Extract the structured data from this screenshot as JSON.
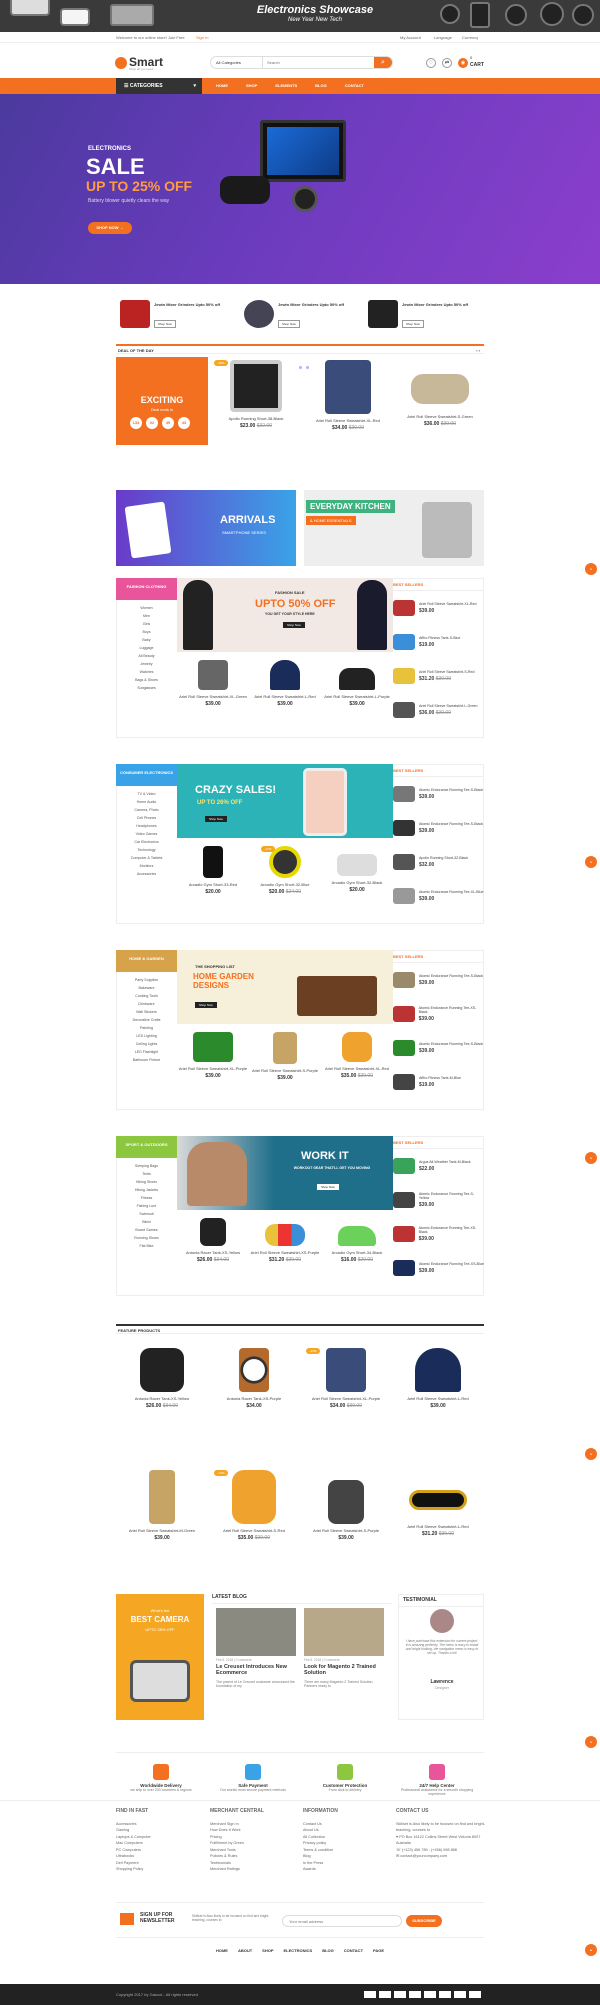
{
  "top_banner": {
    "title": "Electronics Showcase",
    "subtitle": "New Year New Tech"
  },
  "top_bar": {
    "welcome": "Welcome to our online store! Join Free",
    "signin": "Sign In",
    "account": "My Account",
    "language": "Language",
    "currency": "Currency"
  },
  "header": {
    "logo": "Smart",
    "tagline": "Shop all you need",
    "search_category": "All Categories",
    "search_placeholder": "Search",
    "cart_count": "0",
    "cart_label": "CART"
  },
  "nav": {
    "categories_label": "CATEGORIES",
    "items": [
      "HOME",
      "SHOP",
      "ELEMENTS",
      "BLOG",
      "CONTACT"
    ]
  },
  "hero": {
    "label": "ELECTRONICS",
    "sale": "SALE",
    "off": "UP TO 25% OFF",
    "desc": "Battery blower quietly clears the way",
    "button": "SHOP NOW"
  },
  "promos": [
    {
      "title": "Jewin Mixer Grinders Upto 50% off",
      "button": "Shop Now"
    },
    {
      "title": "Jewin Mixer Grinders Upto 50% off",
      "button": "Shop Now"
    },
    {
      "title": "Jewin Mixer Grinders Upto 50% off",
      "button": "Shop Now"
    }
  ],
  "deal": {
    "heading": "DEAL OF THE DAY",
    "exciting": "EXCITING",
    "ends": "Deal ends in",
    "timer": [
      "133",
      "02",
      "49",
      "43"
    ],
    "products": [
      {
        "name": "Apollo Running Short-38-Black",
        "price": "$23.00",
        "old": "$32.00"
      },
      {
        "name": "Ariel Roll Sleeve Sweatshirt-XL-Red",
        "price": "$34.00",
        "old": "$39.00"
      },
      {
        "name": "Ariel Roll Sleeve Sweatshirt-S-Green",
        "price": "$36.00",
        "old": "$39.00"
      }
    ]
  },
  "banners": {
    "arrivals": "ARRIVALS",
    "arrivals_sub": "SMARTPHONE SERIES",
    "kitchen": "EVERYDAY KITCHEN",
    "kitchen_sub": "& HOME ESSENTIALS"
  },
  "fashion": {
    "heading": "FASHION CLOTHING",
    "categories": [
      "Women",
      "Men",
      "Girls",
      "Boys",
      "Baby",
      "Luggage",
      "All Beauty",
      "Jewelry",
      "Watches",
      "Bags & Shoes",
      "Sunglasses"
    ],
    "banner_label": "FASHION SALE",
    "banner_title": "UPTO 50% OFF",
    "banner_sub": "YOU GET YOUR STYLE HERE",
    "banner_btn": "Shop Now",
    "products": [
      {
        "name": "Ariel Roll Sleeve Sweatshirt-XL-Green",
        "price": "$39.00"
      },
      {
        "name": "Ariel Roll Sleeve Sweatshirt-L-Red",
        "price": "$39.00"
      },
      {
        "name": "Ariel Roll Sleeve Sweatshirt-L-Purple",
        "price": "$39.00"
      }
    ],
    "best_head": "BEST SELLERS",
    "best": [
      {
        "name": "Ariel Roll Sleeve Sweatshirt-XL-Red",
        "price": "$39.00"
      },
      {
        "name": "Affiro Fitness Tank-S-Blue",
        "price": "$19.00"
      },
      {
        "name": "Ariel Roll Sleeve Sweatshirt-S-Red",
        "price": "$31.20",
        "old": "$39.00"
      },
      {
        "name": "Ariel Roll Sleeve Sweatshirt-L-Green",
        "price": "$36.00",
        "old": "$39.00"
      }
    ]
  },
  "consumer": {
    "heading": "CONSUMER ELECTRONICS",
    "categories": [
      "TV & Video",
      "Home Audio",
      "Camera, Photo",
      "Cell Phones",
      "Headphones",
      "Video Games",
      "Car Electronics",
      "Technology",
      "Computer & Tablets",
      "Monitors",
      "Accessories"
    ],
    "banner_title": "CRAZY SALES!",
    "banner_sub": "UP TO 26% OFF",
    "banner_btn": "Shop Now",
    "products": [
      {
        "name": "Arcadio Gym Short-33-Red",
        "price": "$20.00"
      },
      {
        "name": "Arcadio Gym Short-32-Blue",
        "price": "$20.00",
        "old": "$24.00"
      },
      {
        "name": "Arcadio Gym Short-32-Black",
        "price": "$20.00"
      }
    ],
    "best_head": "BEST SELLERS",
    "best": [
      {
        "name": "Atomic Endurance Running Tee-S-Black",
        "price": "$39.00"
      },
      {
        "name": "Atomic Endurance Running Tee-S-Black",
        "price": "$39.00"
      },
      {
        "name": "Apollo Running Short-32-Black",
        "price": "$32.00"
      },
      {
        "name": "Atomic Endurance Running Tee-XL-Blue",
        "price": "$39.00"
      }
    ]
  },
  "garden": {
    "heading": "HOME & GARDEN",
    "categories": [
      "Party Supplies",
      "Bakeware",
      "Cooking Tools",
      "Drinkware",
      "Wall Stickers",
      "Decorative Crafts",
      "Painting",
      "LED Lighting",
      "Ceiling Lights",
      "LED Flashlight",
      "Bathroom Fixture"
    ],
    "banner_label": "THE SHOPPING LIST",
    "banner_title": "HOME GARDEN DESIGNS",
    "banner_btn": "Shop Now",
    "products": [
      {
        "name": "Ariel Roll Sleeve Sweatshirt-XL-Purple",
        "price": "$39.00"
      },
      {
        "name": "Ariel Roll Sleeve Sweatshirt-S-Purple",
        "price": "$39.00"
      },
      {
        "name": "Ariel Roll Sleeve Sweatshirt-XL-Red",
        "price": "$35.00",
        "old": "$39.00"
      }
    ],
    "best_head": "BEST SELLERS",
    "best": [
      {
        "name": "Atomic Endurance Running Tee-S-Black",
        "price": "$39.00"
      },
      {
        "name": "Atomic Endurance Running Tee-XS-Black",
        "price": "$39.00"
      },
      {
        "name": "Atomic Endurance Running Tee-S-Black",
        "price": "$39.00"
      },
      {
        "name": "Affiro Fitness Tank-M-Blue",
        "price": "$19.00"
      }
    ]
  },
  "sport": {
    "heading": "SPORT & OUTDOORS",
    "categories": [
      "Sleeping Bags",
      "Tents",
      "Hiking Shoes",
      "Hiking Jackets",
      "Fitness",
      "Fishing Lure",
      "Swimsuit",
      "Bikini",
      "Board Games",
      "Running Shoes",
      "Flat Bike"
    ],
    "banner_title": "WORK IT",
    "banner_sub": "WORKOUT GEAR THAT'LL GET YOU MOVING",
    "banner_btn": "Shop Now",
    "products": [
      {
        "name": "Antonia Racer Tank-XS-Yellow",
        "price": "$26.00",
        "old": "$34.00"
      },
      {
        "name": "Ariel Roll Sleeve Sweatshirt-XS-Purple",
        "price": "$31.20",
        "old": "$39.00"
      },
      {
        "name": "Arcadio Gym Short-34-Black",
        "price": "$16.00",
        "old": "$20.00"
      }
    ],
    "best_head": "BEST SELLERS",
    "best": [
      {
        "name": "Argus All-Weather Tank-M-Black",
        "price": "$22.00"
      },
      {
        "name": "Atomic Endurance Running Tee-S-Yellow",
        "price": "$39.00"
      },
      {
        "name": "Atomic Endurance Running Tee-XS-Black",
        "price": "$39.00"
      },
      {
        "name": "Atomic Endurance Running Tee-XS-Blue",
        "price": "$39.00"
      }
    ]
  },
  "featured": {
    "heading": "FEATURE PRODUCTS",
    "products": [
      {
        "name": "Antonia Racer Tank-XS-Yellow",
        "price": "$26.00",
        "old": "$34.00"
      },
      {
        "name": "Antonia Racer Tank-XS-Purple",
        "price": "$34.00"
      },
      {
        "name": "Ariel Roll Sleeve Sweatshirt-XL-Purple",
        "price": "$34.00",
        "old": "$39.00"
      },
      {
        "name": "Ariel Roll Sleeve Sweatshirt-L-Red",
        "price": "$39.00"
      },
      {
        "name": "Ariel Roll Sleeve Sweatshirt-M-Green",
        "price": "$39.00"
      },
      {
        "name": "Ariel Roll Sleeve Sweatshirt-S-Red",
        "price": "$35.00",
        "old": "$39.00"
      },
      {
        "name": "Ariel Roll Sleeve Sweatshirt-S-Purple",
        "price": "$39.00"
      },
      {
        "name": "Ariel Roll Sleeve Sweatshirt-L-Red",
        "price": "$31.20",
        "old": "$39.00"
      }
    ]
  },
  "camera_ad": {
    "label": "What's the",
    "title": "BEST CAMERA",
    "sub": "UPTO 35% OFF"
  },
  "blog": {
    "heading": "LATEST BLOG",
    "posts": [
      {
        "meta": "Feb 5, 2018 | 0 comment",
        "title": "Le Creuset Introduces New Ecommerce",
        "excerpt": "The parent of Le Creuset cookware announced the foundation of my"
      },
      {
        "meta": "Feb 5, 2018 | 0 comment",
        "title": "Look for Magento 2 Trained Solution",
        "excerpt": "There are many Magento 2 Trained Solution Partners ready to"
      }
    ]
  },
  "testimonial": {
    "heading": "TESTIMONIAL",
    "quote": "I have purchase this extension for current project. It is amazing perfectly. The menu is easy to install and bright looking, the navigation menu is easy to set up. Thanks a lot!",
    "name": "Lawrence",
    "role": "Designer"
  },
  "features": [
    {
      "title": "Worldwide Delivery",
      "desc": "we ship to over 200 countries & regions"
    },
    {
      "title": "Safe Payment",
      "desc": "Our worlds most secure payment methods"
    },
    {
      "title": "Customer Protection",
      "desc": "From click to delivery"
    },
    {
      "title": "24/7 Help Center",
      "desc": "Professional assistance for a smooth shopping experience"
    }
  ],
  "footer": {
    "cols": [
      {
        "title": "FIND IN FAST",
        "items": [
          "Accessories",
          "Gaming",
          "Laptops & Computer",
          "Mac Computers",
          "PC Computers",
          "Ultrabooks",
          "Dell Payment",
          "Shopping Policy"
        ]
      },
      {
        "title": "MERCHANT CENTRAL",
        "items": [
          "Merchant Sign In",
          "How Does It Work",
          "Pricing",
          "Fulfillment by Green",
          "Merchant Tools",
          "Policies & Rules",
          "Testimonials",
          "Merchant Ratings"
        ]
      },
      {
        "title": "INFORMATION",
        "items": [
          "Contact Us",
          "About Us",
          "All Collection",
          "Privacy policy",
          "Terms & condition",
          "Blog",
          "In the Press",
          "Awards"
        ]
      }
    ],
    "contact_title": "CONTACT US",
    "contact_text": "Skillset is Also likely to be focused on find and bright-teaching, courses to",
    "contact_lines": [
      "PO Box 16122 Collins Street West Victoria 8007 Australia",
      "(+123) 456 789 - (+456) 098 888",
      "contact@yourcompany.com"
    ],
    "newsletter_title": "SIGN UP FOR NEWSLETTER",
    "newsletter_text": "Skillset is Also likely to be focused on find and bright-teaching, courses to",
    "newsletter_placeholder": "Your email address",
    "newsletter_btn": "SUBSCRIBE",
    "links": [
      "HOME",
      "ABOUT",
      "SHOP",
      "ELECTRONICS",
      "BLOG",
      "CONTACT",
      "PAGE"
    ],
    "copyright": "Copyright 2017 by Gauvot - All rights reserved"
  },
  "colors": {
    "accent": "#f37021"
  }
}
